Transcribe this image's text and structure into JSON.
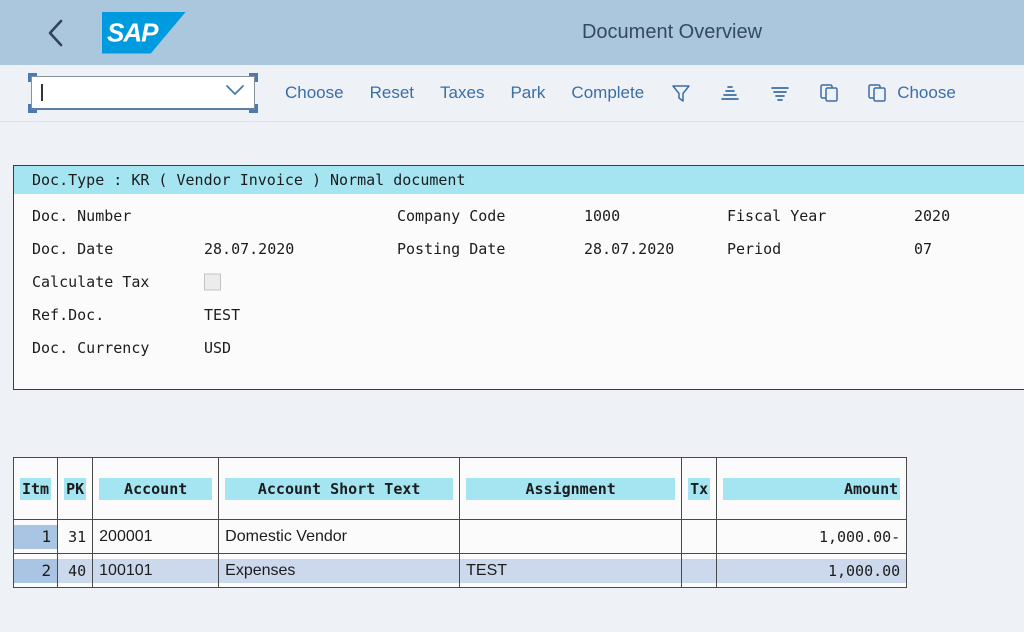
{
  "shell": {
    "title": "Document Overview",
    "logo_text": "SAP",
    "back_icon": "chevron-left-icon"
  },
  "toolbar": {
    "combo_value": "",
    "combo_placeholder": "",
    "actions": [
      {
        "label": "Choose",
        "icon": ""
      },
      {
        "label": "Reset",
        "icon": ""
      },
      {
        "label": "Taxes",
        "icon": ""
      },
      {
        "label": "Park",
        "icon": ""
      },
      {
        "label": "Complete",
        "icon": ""
      }
    ],
    "icon_actions": [
      {
        "icon": "filter-icon",
        "label": ""
      },
      {
        "icon": "sort-ascending-icon",
        "label": ""
      },
      {
        "icon": "sort-descending-icon",
        "label": ""
      },
      {
        "icon": "copy-icon",
        "label": ""
      },
      {
        "icon": "copy-icon",
        "label": "Choose"
      }
    ]
  },
  "document": {
    "title": "Doc.Type : KR ( Vendor Invoice ) Normal document",
    "fields": {
      "doc_number_label": "Doc. Number",
      "doc_number_value": "",
      "company_code_label": "Company Code",
      "company_code_value": "1000",
      "fiscal_year_label": "Fiscal Year",
      "fiscal_year_value": "2020",
      "doc_date_label": "Doc. Date",
      "doc_date_value": "28.07.2020",
      "posting_date_label": "Posting Date",
      "posting_date_value": "28.07.2020",
      "period_label": "Period",
      "period_value": "07",
      "calculate_tax_label": "Calculate Tax",
      "calculate_tax_checked": false,
      "ref_doc_label": "Ref.Doc.",
      "ref_doc_value": "TEST",
      "doc_currency_label": "Doc. Currency",
      "doc_currency_value": "USD"
    }
  },
  "items": {
    "columns": [
      "Itm",
      "PK",
      "Account",
      "Account Short Text",
      "Assignment",
      "Tx",
      "Amount"
    ],
    "rows": [
      {
        "itm": "1",
        "pk": "31",
        "account": "200001",
        "account_short_text": "Domestic Vendor",
        "assignment": "",
        "tx": "",
        "amount": "1,000.00-",
        "selected": false
      },
      {
        "itm": "2",
        "pk": "40",
        "account": "100101",
        "account_short_text": "Expenses",
        "assignment": "TEST",
        "tx": "",
        "amount": "1,000.00",
        "selected": true
      }
    ]
  },
  "colors": {
    "shell_header": "#aac7dd",
    "accent_blue": "#3b6ea5",
    "highlight_cyan": "#a5e5f2",
    "row_selected": "#ccd9ec",
    "itm_cell": "#a9c5e3",
    "sap_logo": "#009ade"
  }
}
